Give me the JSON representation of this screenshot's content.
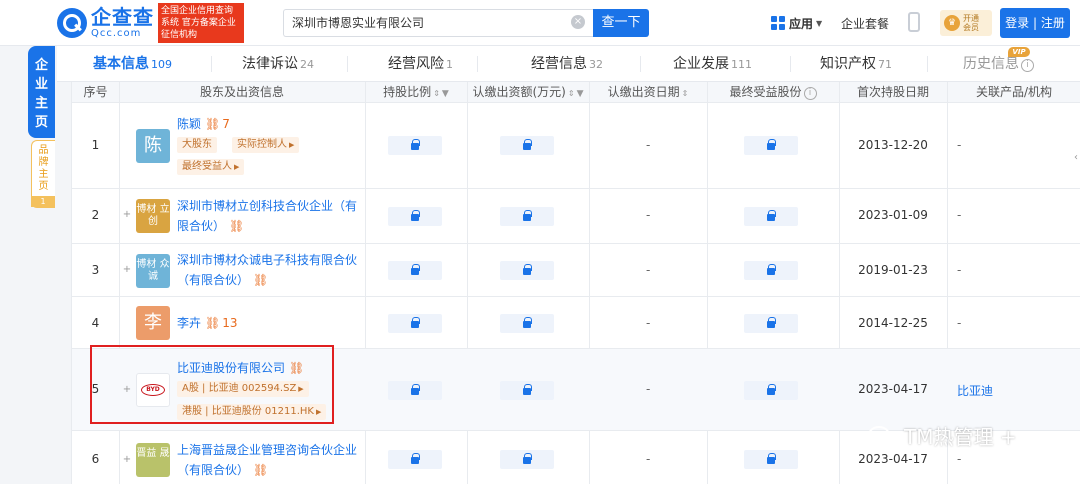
{
  "header": {
    "logo_cn": "企查查",
    "logo_en": "Qcc.com",
    "logo_badge": "全国企业信用查询系统 官方备案企业征信机构",
    "search_value": "深圳市博恩实业有限公司",
    "search_button": "查一下",
    "app_menu": "应用",
    "suite_link": "企业套餐",
    "vip_open": "开通会员",
    "login": "登录 | 注册"
  },
  "side_nav": {
    "main_chars": [
      "企",
      "业",
      "主",
      "页"
    ],
    "brand_chars": [
      "品",
      "牌",
      "主",
      "页"
    ],
    "brand_count": "1"
  },
  "tabs": [
    {
      "label": "基本信息",
      "count": "109"
    },
    {
      "label": "法律诉讼",
      "count": "24"
    },
    {
      "label": "经营风险",
      "count": "1"
    },
    {
      "label": "经营信息",
      "count": "32"
    },
    {
      "label": "企业发展",
      "count": "111"
    },
    {
      "label": "知识产权",
      "count": "71"
    },
    {
      "label": "历史信息",
      "count": ""
    }
  ],
  "vip_badge": "VIP",
  "table": {
    "headers": [
      "序号",
      "股东及出资信息",
      "持股比例",
      "认缴出资额(万元)",
      "认缴出资日期",
      "最终受益股份",
      "首次持股日期",
      "关联产品/机构"
    ],
    "rows": [
      {
        "index": "1",
        "avatar": "陈",
        "name": "陈颖",
        "hold_count": "7",
        "tags": [
          "大股东",
          "实际控制人",
          "最终受益人"
        ],
        "date_sub": "-",
        "first_date": "2013-12-20",
        "related": "-"
      },
      {
        "index": "2",
        "avatar": "博材 立创",
        "name_line1": "深圳市博材立创科技合伙企业（有",
        "name_line2": "限合伙）",
        "date_sub": "-",
        "first_date": "2023-01-09",
        "related": "-"
      },
      {
        "index": "3",
        "avatar": "博材 众诚",
        "name_line1": "深圳市博材众诚电子科技有限合伙",
        "name_line2": "（有限合伙）",
        "date_sub": "-",
        "first_date": "2019-01-23",
        "related": "-"
      },
      {
        "index": "4",
        "avatar": "李",
        "name": "李卉",
        "hold_count": "13",
        "date_sub": "-",
        "first_date": "2014-12-25",
        "related": "-"
      },
      {
        "index": "5",
        "avatar": "BYD",
        "name": "比亚迪股份有限公司",
        "tags": [
          "A股 | 比亚迪 002594.SZ",
          "港股 | 比亚迪股份 01211.HK"
        ],
        "date_sub": "-",
        "first_date": "2023-04-17",
        "related": "比亚迪"
      },
      {
        "index": "6",
        "avatar": "晋益 晟",
        "name_line1": "上海晋益晟企业管理咨询合伙企业",
        "name_line2": "（有限合伙）",
        "date_sub": "-",
        "first_date": "2023-04-17",
        "related": "-"
      }
    ]
  },
  "watermark": "TM热管理 +",
  "colors": {
    "brand": "#1a73e8",
    "highlight": "#e02020",
    "tag": "#c0712d"
  }
}
